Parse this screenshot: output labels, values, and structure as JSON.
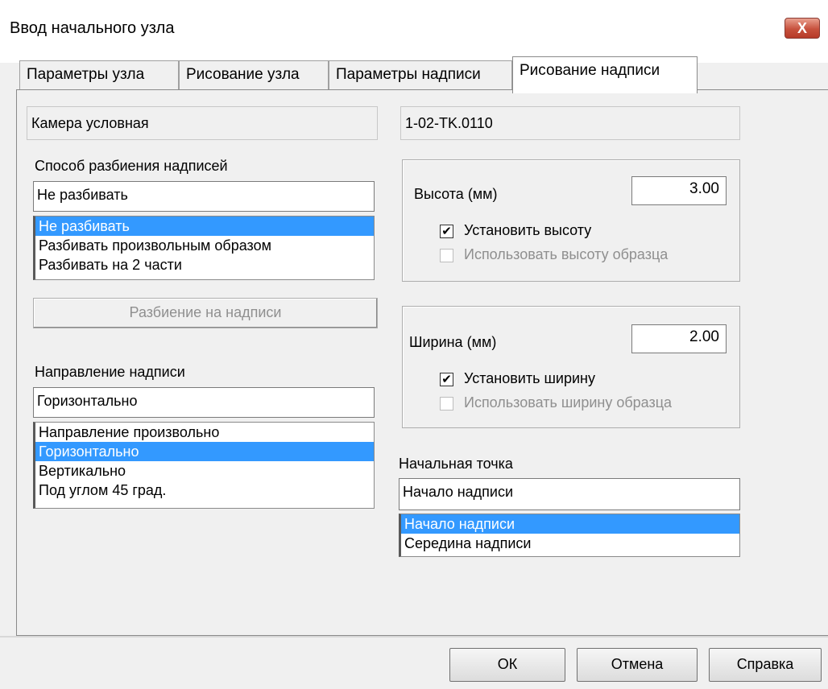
{
  "window": {
    "title": "Ввод начального узла",
    "close_glyph": "X"
  },
  "tabs": [
    {
      "label": "Параметры узла",
      "active": false
    },
    {
      "label": "Рисование узла",
      "active": false
    },
    {
      "label": "Параметры надписи",
      "active": false
    },
    {
      "label": "Рисование надписи",
      "active": true
    }
  ],
  "node": {
    "type": "Камера условная",
    "code": "1-02-TK.0110"
  },
  "split": {
    "label": "Способ разбиения надписей",
    "value": "Не разбивать",
    "options": [
      "Не разбивать",
      "Разбивать произвольным образом",
      "Разбивать на 2 части"
    ],
    "selected_index": 0,
    "button_label": "Разбиение на надписи"
  },
  "direction": {
    "label": "Направление надписи",
    "value": "Горизонтально",
    "options": [
      "Направление произвольно",
      "Горизонтально",
      "Вертикально",
      "Под углом 45 град."
    ],
    "selected_index": 1
  },
  "height": {
    "label": "Высота (мм)",
    "value": "3.00",
    "set_label": "Установить высоту",
    "set_checked": true,
    "sample_label": "Использовать высоту образца",
    "sample_checked": false,
    "sample_disabled": true
  },
  "width": {
    "label": "Ширина (мм)",
    "value": "2.00",
    "set_label": "Установить ширину",
    "set_checked": true,
    "sample_label": "Использовать ширину образца",
    "sample_checked": false,
    "sample_disabled": true
  },
  "start_point": {
    "label": "Начальная точка",
    "value": "Начало надписи",
    "options": [
      "Начало надписи",
      "Середина надписи"
    ],
    "selected_index": 0
  },
  "buttons": {
    "ok": "ОК",
    "cancel": "Отмена",
    "help": "Справка"
  },
  "icons": {
    "checkmark": "✔",
    "close": "close-icon"
  },
  "colors": {
    "selection": "#3399ff",
    "close_button": "#c7513d"
  }
}
